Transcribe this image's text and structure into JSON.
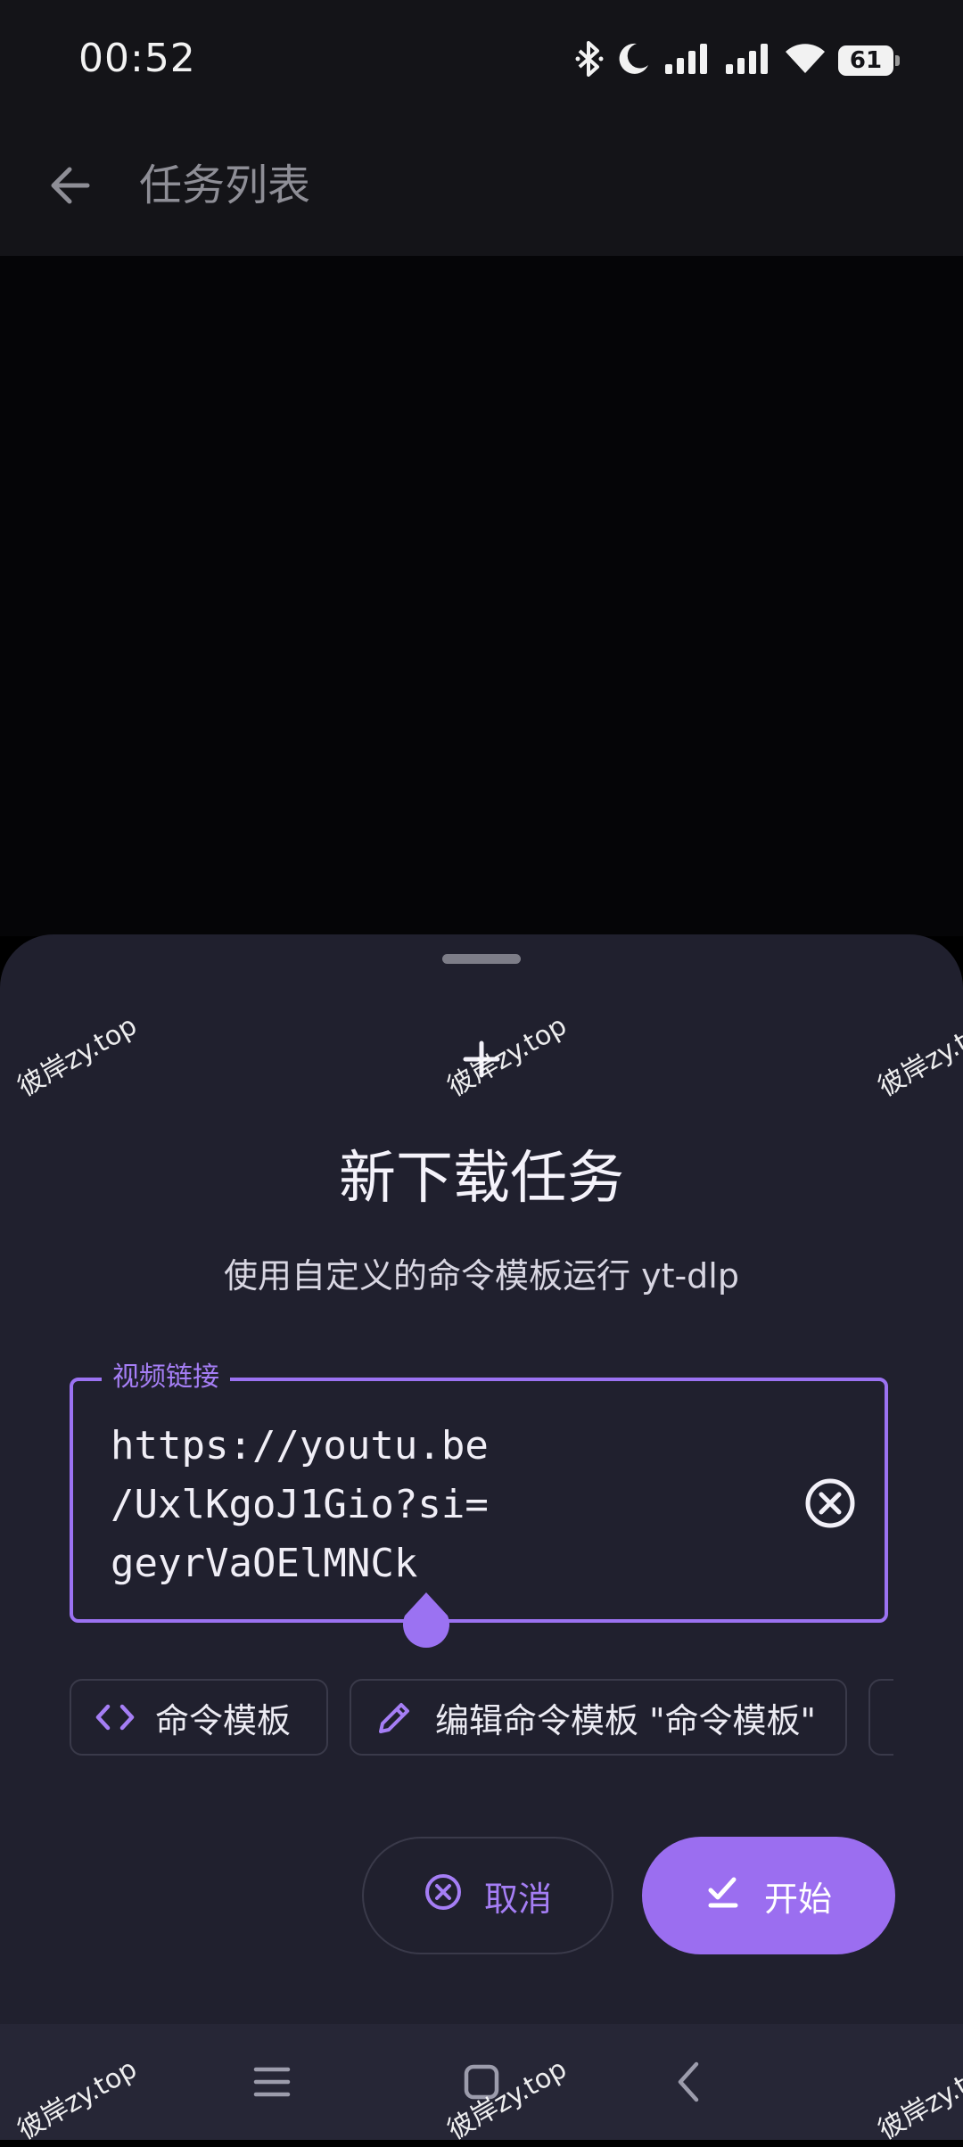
{
  "status_bar": {
    "time": "00:52",
    "battery": "61",
    "icons": [
      "bluetooth-icon",
      "moon-icon",
      "signal-icon",
      "signal-icon",
      "wifi-icon"
    ]
  },
  "app_bar": {
    "title": "任务列表"
  },
  "sheet": {
    "title": "新下载任务",
    "subtitle": "使用自定义的命令模板运行 yt-dlp",
    "url_field": {
      "label": "视频链接",
      "value": "https://youtu.be\n/UxlKgoJ1Gio?si=\ngeyrVaOElMNCk"
    },
    "chips": [
      {
        "label": "命令模板",
        "icon": "code-icon"
      },
      {
        "label": "编辑命令模板 \"命令模板\"",
        "icon": "pencil-icon"
      }
    ],
    "cancel_label": "取消",
    "start_label": "开始"
  },
  "watermark": "彼岸zy.top",
  "colors": {
    "accent": "#9b6ef0",
    "sheet_bg": "#20202e",
    "app_bar_bg": "#141418",
    "nav_bg": "#262636"
  }
}
